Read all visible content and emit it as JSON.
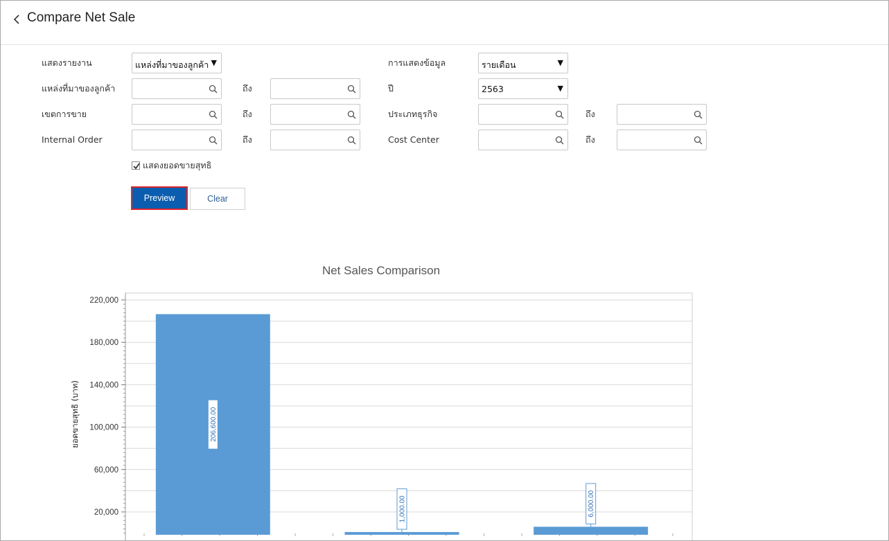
{
  "header": {
    "title": "Compare Net Sale",
    "back_icon": "chevron-left-icon"
  },
  "form": {
    "report_label": "แสดงรายงาน",
    "report_value": "แหล่งที่มาของลูกค้า",
    "display_label": "การแสดงข้อมูล",
    "display_value": "รายเดือน",
    "source_label": "แหล่งที่มาของลูกค้า",
    "to_label": "ถึง",
    "year_label": "ปี",
    "year_value": "2563",
    "sales_area_label": "เขตการขาย",
    "business_type_label": "ประเภทธุรกิจ",
    "internal_order_label": "Internal Order",
    "cost_center_label": "Cost Center",
    "show_net_sales_label": "แสดงยอดขายสุทธิ",
    "show_net_sales_checked": true,
    "preview_label": "Preview",
    "clear_label": "Clear"
  },
  "colors": {
    "primary": "#0b5eaf",
    "highlight": "#e0242a",
    "bar": "#5b9bd5"
  },
  "chart_data": {
    "type": "bar",
    "title": "Net Sales Comparison",
    "ylabel": "ยอดขายสุทธิ (บาท)",
    "xlabel": "",
    "categories": [
      "",
      "",
      ""
    ],
    "values": [
      206600,
      1000,
      6000
    ],
    "data_labels": [
      "206,600.00",
      "1,000.00",
      "6,000.00"
    ],
    "y_ticks": [
      20000,
      60000,
      100000,
      140000,
      180000,
      220000
    ],
    "y_tick_labels": [
      "20,000",
      "60,000",
      "100,000",
      "140,000",
      "180,000",
      "220,000"
    ],
    "ylim": [
      0,
      220000
    ],
    "grid": true
  }
}
